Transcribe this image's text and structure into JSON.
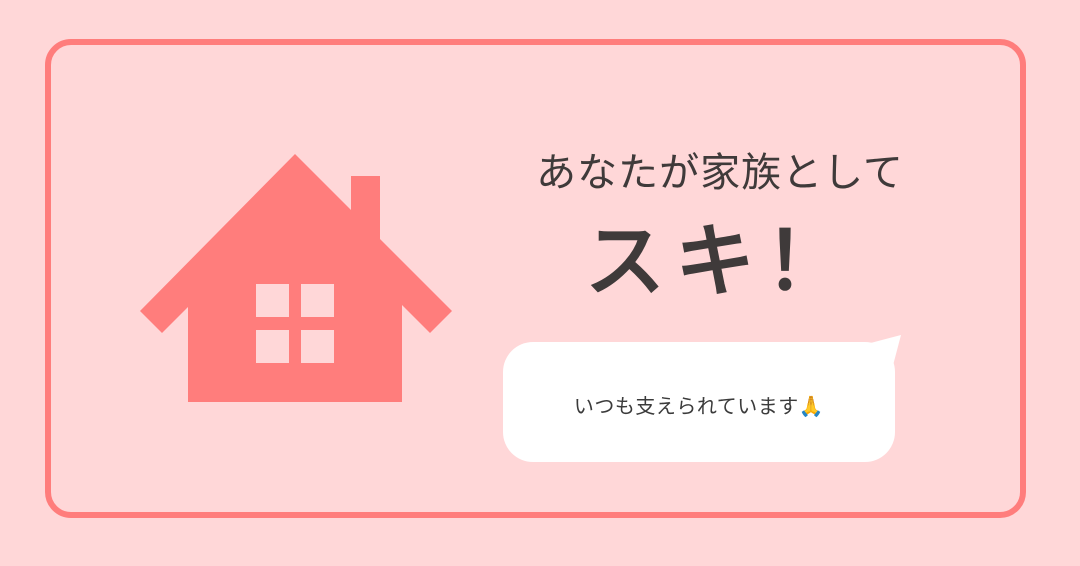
{
  "card": {
    "headline_line1": "あなたが家族として",
    "headline_line2": "スキ！",
    "bubble_text": "いつも支えられています🙏"
  },
  "icons": {
    "main": "house-icon",
    "bubble": "speech-bubble"
  },
  "colors": {
    "background": "#ffd7d8",
    "accent": "#ff7d7c",
    "text": "#3f3a3a",
    "bubble": "#ffffff"
  }
}
